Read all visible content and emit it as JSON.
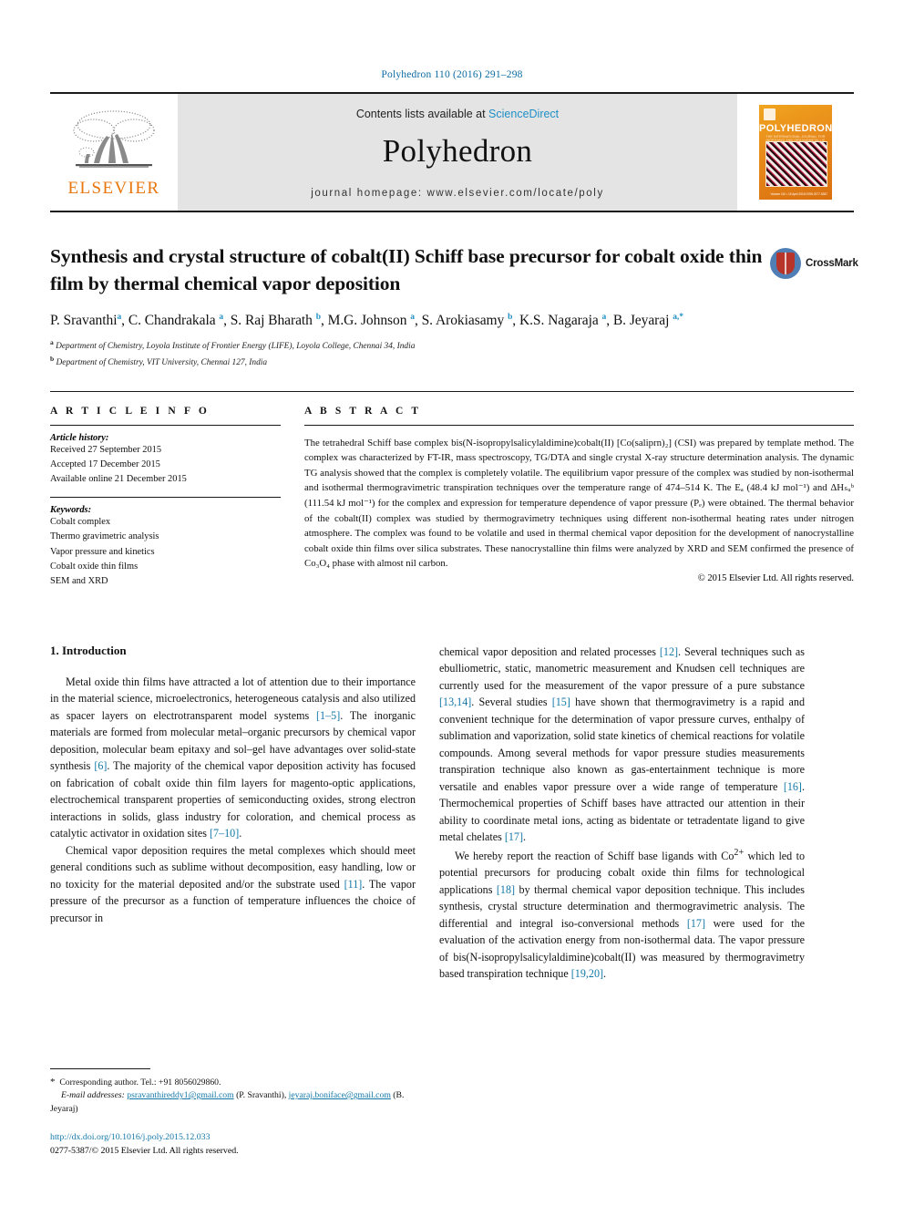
{
  "running_head": "Polyhedron 110 (2016) 291–298",
  "banner": {
    "publisher": "ELSEVIER",
    "contents_prefix": "Contents lists available at ",
    "contents_link": "ScienceDirect",
    "journal_title": "Polyhedron",
    "homepage": "journal homepage: www.elsevier.com/locate/poly",
    "cover": {
      "title": "POLYHEDRON",
      "subtitle": "THE INTERNATIONAL JOURNAL FOR INORGANIC AND ORGANOMETALLIC CHEMISTRY",
      "footer": "Volume 110 • 15 April 2016\nISSN 0277-5387"
    }
  },
  "article": {
    "title": "Synthesis and crystal structure of cobalt(II) Schiff base precursor for cobalt oxide thin film by thermal chemical vapor deposition",
    "crossmark_label": "CrossMark",
    "authors": [
      {
        "name": "P. Sravanthi",
        "sup": "a"
      },
      {
        "name": "C. Chandrakala",
        "sup": "a"
      },
      {
        "name": "S. Raj Bharath",
        "sup": "b"
      },
      {
        "name": "M.G. Johnson",
        "sup": "a"
      },
      {
        "name": "S. Arokiasamy",
        "sup": "b"
      },
      {
        "name": "K.S. Nagaraja",
        "sup": "a"
      },
      {
        "name": "B. Jeyaraj",
        "sup": "a,*"
      }
    ],
    "affiliations": [
      {
        "mark": "a",
        "text": "Department of Chemistry, Loyola Institute of Frontier Energy (LIFE), Loyola College, Chennai 34, India"
      },
      {
        "mark": "b",
        "text": "Department of Chemistry, VIT University, Chennai 127, India"
      }
    ]
  },
  "article_info": {
    "heading": "A R T I C L E  I N F O",
    "history_label": "Article history:",
    "history": [
      "Received 27 September 2015",
      "Accepted 17 December 2015",
      "Available online 21 December 2015"
    ],
    "keywords_label": "Keywords:",
    "keywords": [
      "Cobalt complex",
      "Thermo gravimetric analysis",
      "Vapor pressure and kinetics",
      "Cobalt oxide thin films",
      "SEM and XRD"
    ]
  },
  "abstract": {
    "heading": "A B S T R A C T",
    "text": "The tetrahedral Schiff base complex bis(N-isopropylsalicylaldimine)cobalt(II) [Co(saliprn)₂] (CSI) was prepared by template method. The complex was characterized by FT-IR, mass spectroscopy, TG/DTA and single crystal X-ray structure determination analysis. The dynamic TG analysis showed that the complex is completely volatile. The equilibrium vapor pressure of the complex was studied by non-isothermal and isothermal thermogravimetric transpiration techniques over the temperature range of 474–514 K. The Eₐ (48.4 kJ mol⁻¹) and ΔHₛᵤᵇ (111.54 kJ mol⁻¹) for the complex and expression for temperature dependence of vapor pressure (Pₑ) were obtained. The thermal behavior of the cobalt(II) complex was studied by thermogravimetry techniques using different non-isothermal heating rates under nitrogen atmosphere. The complex was found to be volatile and used in thermal chemical vapor deposition for the development of nanocrystalline cobalt oxide thin films over silica substrates. These nanocrystalline thin films were analyzed by XRD and SEM confirmed the presence of Co₃O₄ phase with almost nil carbon.",
    "copyright": "© 2015 Elsevier Ltd. All rights reserved."
  },
  "body": {
    "section_heading": "1. Introduction",
    "left_paragraphs": [
      "Metal oxide thin films have attracted a lot of attention due to their importance in the material science, microelectronics, heterogeneous catalysis and also utilized as spacer layers on electrotransparent model systems [1–5]. The inorganic materials are formed from molecular metal–organic precursors by chemical vapor deposition, molecular beam epitaxy and sol–gel have advantages over solid-state synthesis [6]. The majority of the chemical vapor deposition activity has focused on fabrication of cobalt oxide thin film layers for magento-optic applications, electrochemical transparent properties of semiconducting oxides, strong electron interactions in solids, glass industry for coloration, and chemical process as catalytic activator in oxidation sites [7–10].",
      "Chemical vapor deposition requires the metal complexes which should meet general conditions such as sublime without decomposition, easy handling, low or no toxicity for the material deposited and/or the substrate used [11]. The vapor pressure of the precursor as a function of temperature influences the choice of precursor in"
    ],
    "right_paragraphs": [
      "chemical vapor deposition and related processes [12]. Several techniques such as ebulliometric, static, manometric measurement and Knudsen cell techniques are currently used for the measurement of the vapor pressure of a pure substance [13,14]. Several studies [15] have shown that thermogravimetry is a rapid and convenient technique for the determination of vapor pressure curves, enthalpy of sublimation and vaporization, solid state kinetics of chemical reactions for volatile compounds. Among several methods for vapor pressure studies measurements transpiration technique also known as gas-entertainment technique is more versatile and enables vapor pressure over a wide range of temperature [16]. Thermochemical properties of Schiff bases have attracted our attention in their ability to coordinate metal ions, acting as bidentate or tetradentate ligand to give metal chelates [17].",
      "We hereby report the reaction of Schiff base ligands with Co²⁺ which led to potential precursors for producing cobalt oxide thin films for technological applications [18] by thermal chemical vapor deposition technique. This includes synthesis, crystal structure determination and thermogravimetric analysis. The differential and integral iso-conversional methods [17] were used for the evaluation of the activation energy from non-isothermal data. The vapor pressure of bis(N-isopropylsalicylaldimine)cobalt(II) was measured by thermogravimetry based transpiration technique [19,20]."
    ]
  },
  "footnotes": {
    "corresponding": "Corresponding author. Tel.: +91 8056029860.",
    "email_label": "E-mail addresses:",
    "emails": [
      {
        "address": "psravanthireddy1@gmail.com",
        "owner": "(P. Sravanthi)"
      },
      {
        "address": "jeyaraj.boniface@gmail.com",
        "owner": "(B. Jeyaraj)"
      }
    ],
    "doi": "http://dx.doi.org/10.1016/j.poly.2015.12.033",
    "issn_line": "0277-5387/© 2015 Elsevier Ltd. All rights reserved."
  }
}
